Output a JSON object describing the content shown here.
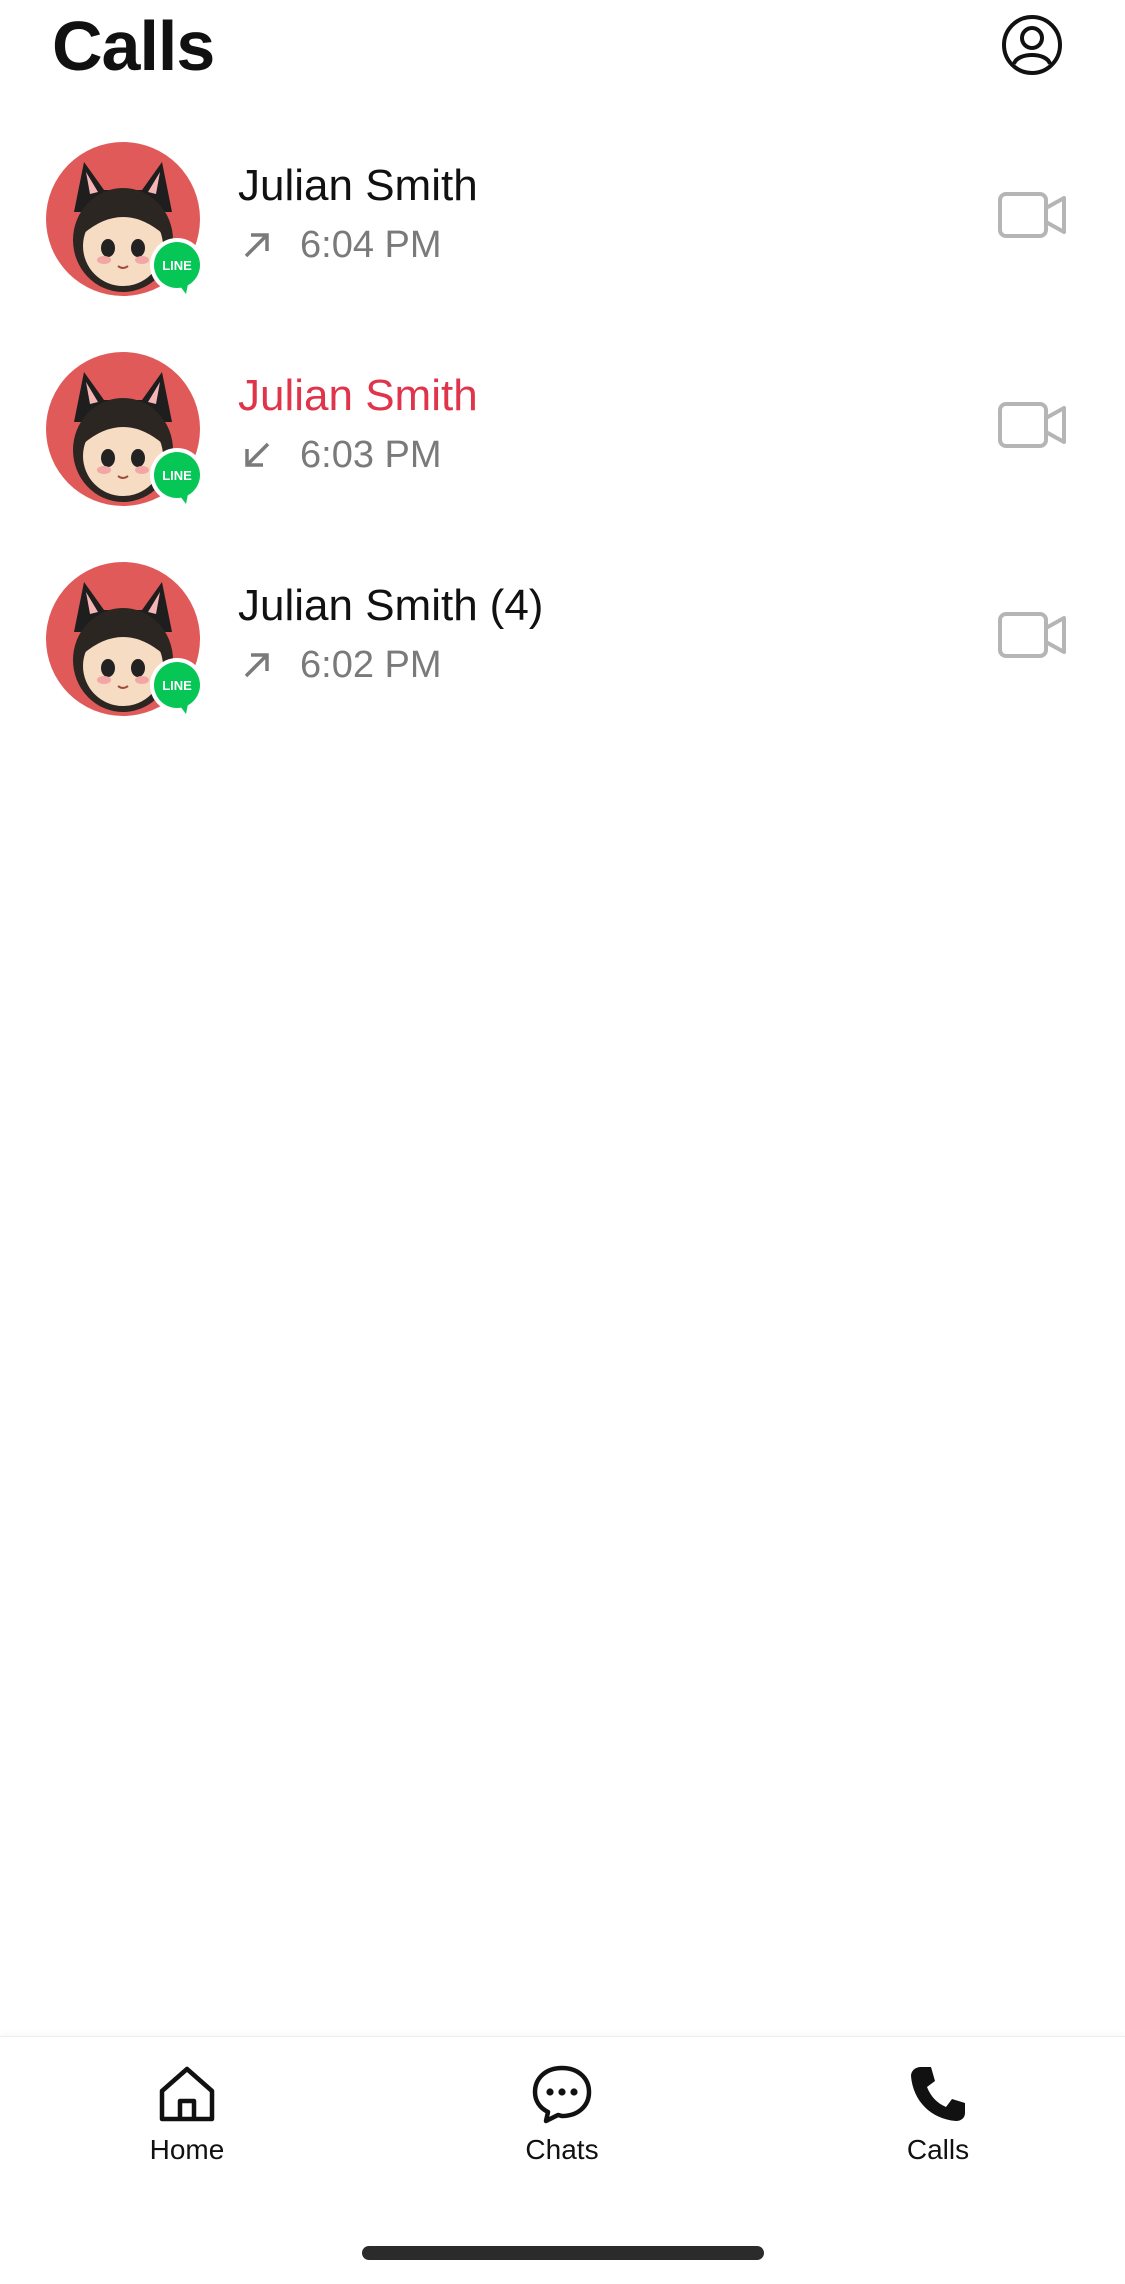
{
  "header": {
    "title": "Calls"
  },
  "colors": {
    "missed": "#e0344a",
    "badge": "#06c755",
    "avatar_bg": "#e05a5a"
  },
  "calls": [
    {
      "name": "Julian Smith",
      "count": "",
      "direction": "outgoing",
      "time": "6:04 PM",
      "missed": false
    },
    {
      "name": "Julian Smith",
      "count": "",
      "direction": "incoming",
      "time": "6:03 PM",
      "missed": true
    },
    {
      "name": "Julian Smith",
      "count": "(4)",
      "direction": "outgoing",
      "time": "6:02 PM",
      "missed": false
    }
  ],
  "badge": {
    "label": "LINE"
  },
  "tabs": [
    {
      "label": "Home",
      "icon": "home-icon"
    },
    {
      "label": "Chats",
      "icon": "chat-bubble-icon"
    },
    {
      "label": "Calls",
      "icon": "phone-icon",
      "active": true
    }
  ]
}
